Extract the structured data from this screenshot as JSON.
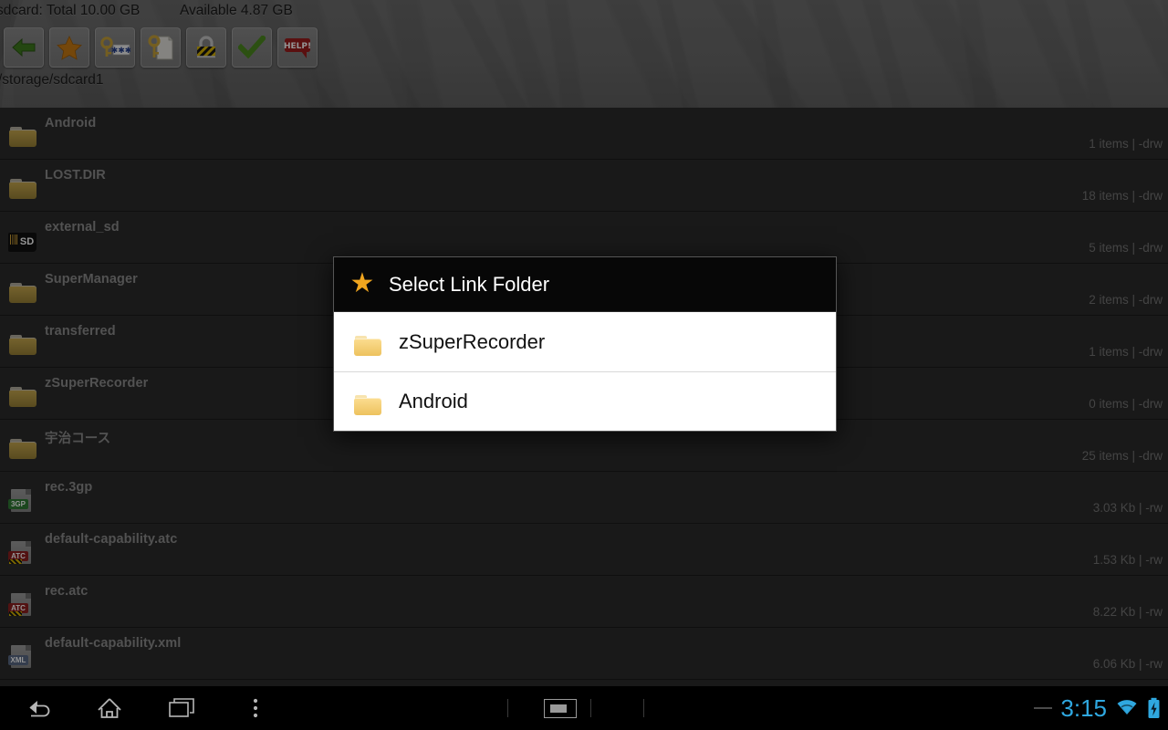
{
  "header": {
    "storage_total": "sdcard: Total 10.00 GB",
    "storage_available": "Available 4.87 GB",
    "current_path": "/storage/sdcard1",
    "toolbar": [
      {
        "name": "back",
        "icon": "green-back-arrow-icon",
        "label": "Back"
      },
      {
        "name": "favorites",
        "icon": "orange-star-icon",
        "label": "Favorites"
      },
      {
        "name": "password",
        "icon": "key-password-icon",
        "label": "Password"
      },
      {
        "name": "key-file",
        "icon": "key-document-icon",
        "label": "Key File"
      },
      {
        "name": "lock",
        "icon": "padlock-striped-icon",
        "label": "Lock"
      },
      {
        "name": "confirm",
        "icon": "green-check-icon",
        "label": "Confirm"
      },
      {
        "name": "help",
        "icon": "help-bubble-icon",
        "label": "Help"
      }
    ]
  },
  "files": [
    {
      "name": "Android",
      "icon": "folder-icon",
      "meta": "1 items | -drw"
    },
    {
      "name": "LOST.DIR",
      "icon": "folder-icon",
      "meta": "18 items | -drw"
    },
    {
      "name": "external_sd",
      "icon": "sdcard-icon",
      "meta": "5 items | -drw"
    },
    {
      "name": "SuperManager",
      "icon": "folder-icon",
      "meta": "2 items | -drw"
    },
    {
      "name": "transferred",
      "icon": "folder-icon",
      "meta": "1 items | -drw"
    },
    {
      "name": "zSuperRecorder",
      "icon": "folder-icon",
      "meta": "0 items | -drw"
    },
    {
      "name": "宇治コース",
      "icon": "folder-icon",
      "meta": "25 items | -drw"
    },
    {
      "name": "rec.3gp",
      "icon": "file-3gp-icon",
      "meta": "3.03 Kb  | -rw"
    },
    {
      "name": "default-capability.atc",
      "icon": "file-atc-icon",
      "meta": "1.53 Kb  | -rw"
    },
    {
      "name": "rec.atc",
      "icon": "file-atc-icon",
      "meta": "8.22 Kb  | -rw"
    },
    {
      "name": "default-capability.xml",
      "icon": "file-xml-icon",
      "meta": "6.06 Kb  | -rw"
    }
  ],
  "dialog": {
    "title": "Select Link Folder",
    "title_icon": "orange-star-icon",
    "items": [
      {
        "label": "zSuperRecorder",
        "icon": "folder-icon"
      },
      {
        "label": "Android",
        "icon": "folder-icon"
      }
    ]
  },
  "navbar": {
    "back": "Back",
    "home": "Home",
    "recents": "Recent apps",
    "menu": "Menu",
    "ime": "Keyboard selector",
    "clock": "3:15",
    "wifi": "wifi-icon",
    "battery": "battery-charging-icon"
  },
  "colors": {
    "accent_star": "#f0a51e",
    "clock_blue": "#2fa8e0",
    "row_bg": "#2c2c2c",
    "header_gray": "#6c6c6c"
  }
}
